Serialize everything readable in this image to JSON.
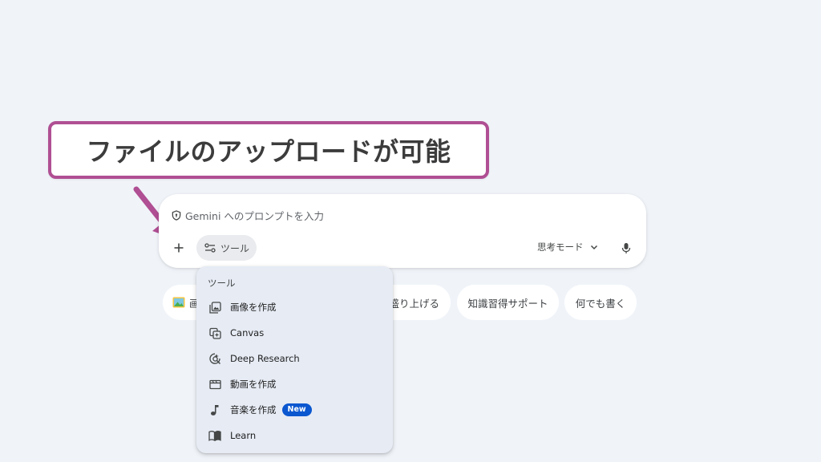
{
  "callout": {
    "text": "ファイルのアップロードが可能",
    "border_color": "#b04f93"
  },
  "prompt": {
    "placeholder": "Gemini へのプロンプトを入力",
    "tools_label": "ツール",
    "mode_label": "思考モード",
    "icons": {
      "shield": "shield-icon",
      "plus": "plus-icon",
      "tools": "tools-sliders-icon",
      "chevron": "chevron-down-icon",
      "mic": "mic-icon"
    }
  },
  "chips": [
    {
      "label": "画",
      "icon": "image-icon"
    },
    {
      "label": "盛り上げる"
    },
    {
      "label": "知識習得サポート"
    },
    {
      "label": "何でも書く"
    }
  ],
  "tools_menu": {
    "header": "ツール",
    "items": [
      {
        "label": "画像を作成",
        "icon": "image-create-icon"
      },
      {
        "label": "Canvas",
        "icon": "canvas-icon"
      },
      {
        "label": "Deep Research",
        "icon": "deep-research-icon"
      },
      {
        "label": "動画を作成",
        "icon": "video-icon"
      },
      {
        "label": "音楽を作成",
        "icon": "music-note-icon",
        "badge": "New"
      },
      {
        "label": "Learn",
        "icon": "book-icon"
      }
    ],
    "badge_color": "#0b57d0"
  },
  "colors": {
    "background": "#f0f4f9",
    "menu_background": "#e6ebf4",
    "accent_arrow": "#b04f93"
  }
}
